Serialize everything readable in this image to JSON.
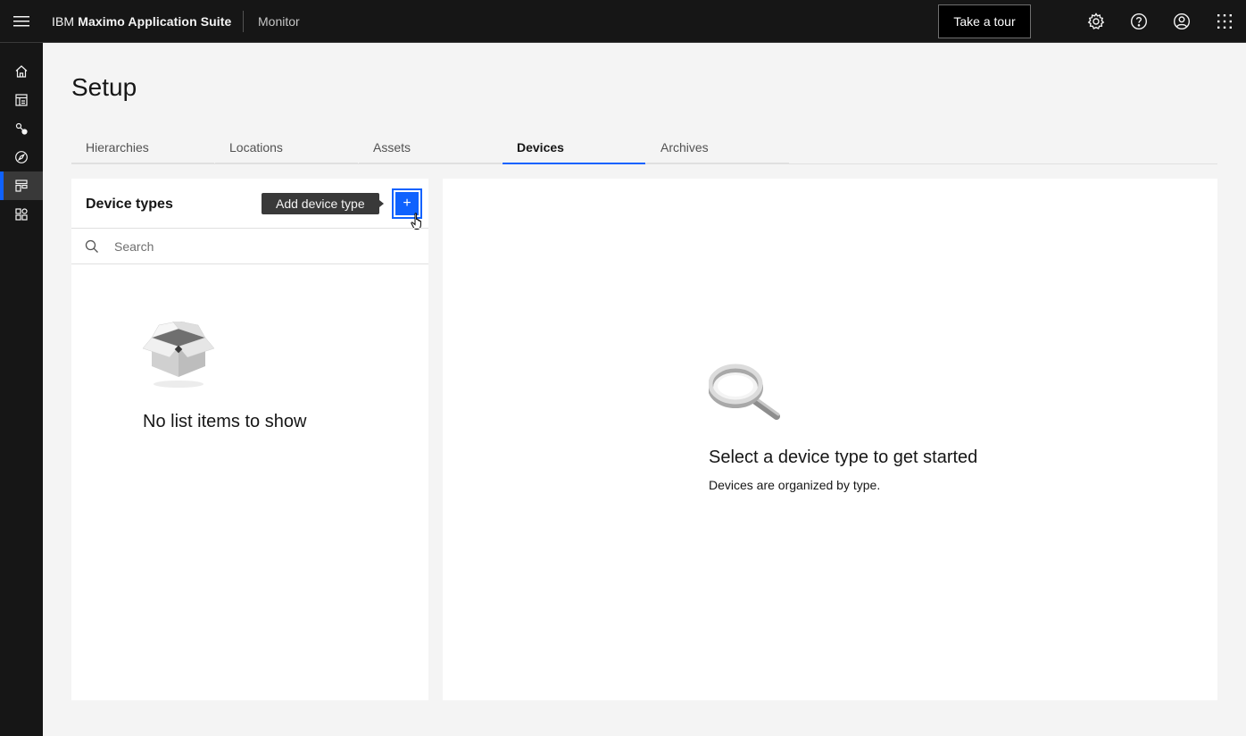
{
  "header": {
    "brand_prefix": "IBM",
    "brand_name": "Maximo Application Suite",
    "app_name": "Monitor",
    "tour_button": "Take a tour",
    "icons": [
      "menu-icon",
      "settings-icon",
      "help-icon",
      "user-icon",
      "app-switcher-icon"
    ]
  },
  "sidenav": {
    "items": [
      {
        "icon": "home-icon"
      },
      {
        "icon": "dashboard-icon"
      },
      {
        "icon": "connection-icon"
      },
      {
        "icon": "compass-icon"
      },
      {
        "icon": "setup-icon",
        "active": true
      },
      {
        "icon": "apps-icon"
      }
    ]
  },
  "page": {
    "title": "Setup",
    "tabs": [
      {
        "label": "Hierarchies"
      },
      {
        "label": "Locations"
      },
      {
        "label": "Assets"
      },
      {
        "label": "Devices",
        "active": true
      },
      {
        "label": "Archives"
      }
    ]
  },
  "left_panel": {
    "title": "Device types",
    "tooltip": "Add device type",
    "add_button": "+",
    "search_placeholder": "Search",
    "empty_text": "No list items to show"
  },
  "right_panel": {
    "title": "Select a device type to get started",
    "subtitle": "Devices are organized by type."
  },
  "colors": {
    "header_bg": "#161616",
    "accent": "#0f62fe",
    "page_bg": "#f4f4f4"
  }
}
